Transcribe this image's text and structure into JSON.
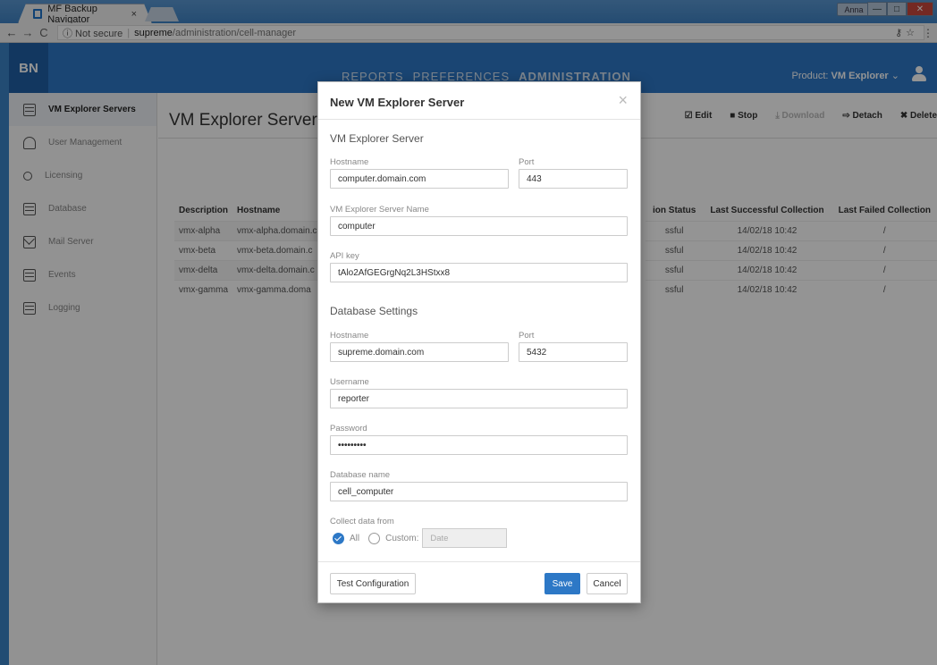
{
  "browser": {
    "tab_title": "MF Backup Navigator",
    "tab_close": "×",
    "security": "ⓘ Not secure",
    "url_host": "supreme",
    "url_path": "/administration/cell-manager",
    "user_badge": "Anna"
  },
  "app": {
    "logo": "BN",
    "nav": [
      "REPORTS",
      "PREFERENCES",
      "ADMINISTRATION"
    ],
    "product_label": "Product:",
    "product_value": "VM Explorer",
    "sidebar": [
      {
        "label": "VM Explorer Servers",
        "icon": "server-icon"
      },
      {
        "label": "User Management",
        "icon": "user-icon"
      },
      {
        "label": "Licensing",
        "icon": "key-icon"
      },
      {
        "label": "Database",
        "icon": "database-icon"
      },
      {
        "label": "Mail Server",
        "icon": "mail-icon"
      },
      {
        "label": "Events",
        "icon": "calendar-icon"
      },
      {
        "label": "Logging",
        "icon": "log-icon"
      }
    ],
    "page_title": "VM Explorer Server",
    "toolbar": {
      "edit": "☑ Edit",
      "stop": "■ Stop",
      "download": "⤓ Download",
      "detach": "⇨ Detach",
      "delete": "✖ Delete"
    },
    "table": {
      "headers": [
        "Description",
        "Hostname"
      ],
      "rows": [
        [
          "vmx-alpha",
          "vmx-alpha.domain.c"
        ],
        [
          "vmx-beta",
          "vmx-beta.domain.c"
        ],
        [
          "vmx-delta",
          "vmx-delta.domain.c"
        ],
        [
          "vmx-gamma",
          "vmx-gamma.doma"
        ]
      ],
      "right_headers": [
        "ion Status",
        "Last Successful Collection",
        "Last Failed Collection"
      ],
      "right_rows": [
        [
          "ssful",
          "14/02/18 10:42",
          "/"
        ],
        [
          "ssful",
          "14/02/18 10:42",
          "/"
        ],
        [
          "ssful",
          "14/02/18 10:42",
          "/"
        ],
        [
          "ssful",
          "14/02/18 10:42",
          "/"
        ]
      ]
    }
  },
  "modal": {
    "title": "New VM Explorer Server",
    "close": "×",
    "vm_section": "VM Explorer Server",
    "vm_hostname_label": "Hostname",
    "vm_hostname": "computer.domain.com",
    "vm_port_label": "Port",
    "vm_port": "443",
    "vm_name_label": "VM Explorer Server Name",
    "vm_name": "computer",
    "api_label": "API key",
    "api_key": "tAlo2AfGEGrgNq2L3HStxx8",
    "db_section": "Database Settings",
    "db_hostname_label": "Hostname",
    "db_hostname": "supreme.domain.com",
    "db_port_label": "Port",
    "db_port": "5432",
    "username_label": "Username",
    "username": "reporter",
    "password_label": "Password",
    "password": "•••••••••",
    "dbname_label": "Database name",
    "dbname": "cell_computer",
    "collect_label": "Collect data from",
    "opt_all": "All",
    "opt_custom": "Custom:",
    "date_placeholder": "Date",
    "test_btn": "Test Configuration",
    "save_btn": "Save",
    "cancel_btn": "Cancel"
  }
}
